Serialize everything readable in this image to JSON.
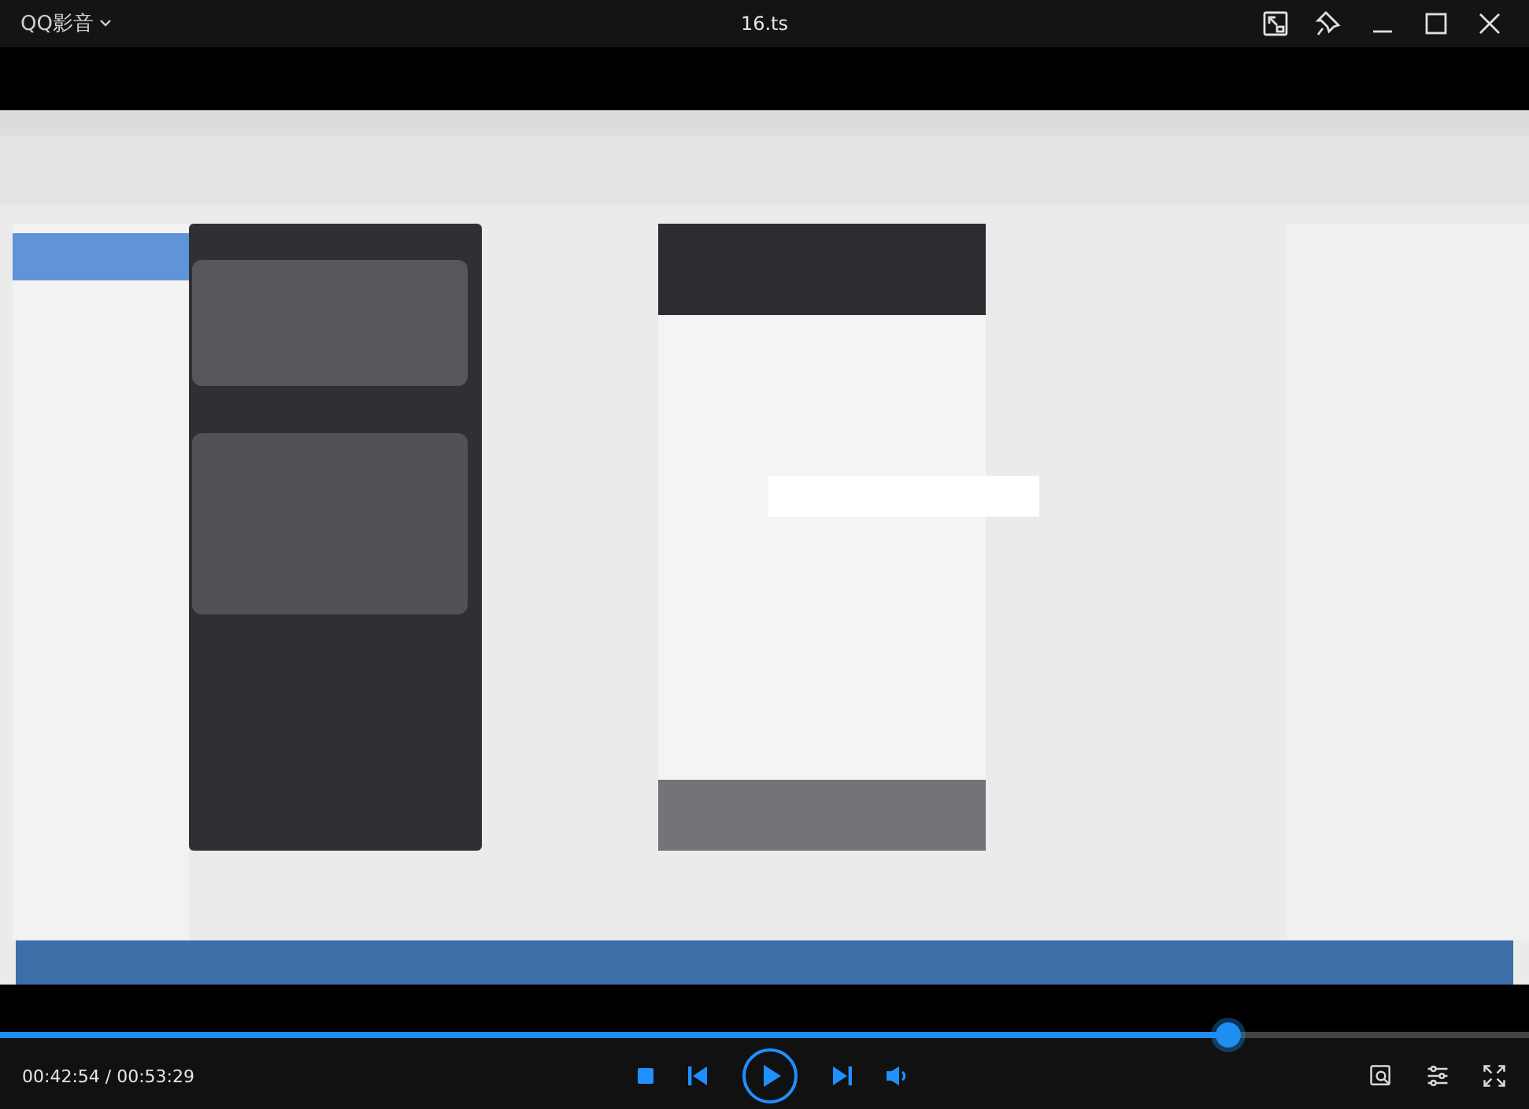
{
  "app": {
    "name": "QQ影音"
  },
  "window": {
    "title": "16.ts"
  },
  "playback": {
    "level": 0.803,
    "time": "00:42:54 / 00:53:29",
    "playing": false
  }
}
